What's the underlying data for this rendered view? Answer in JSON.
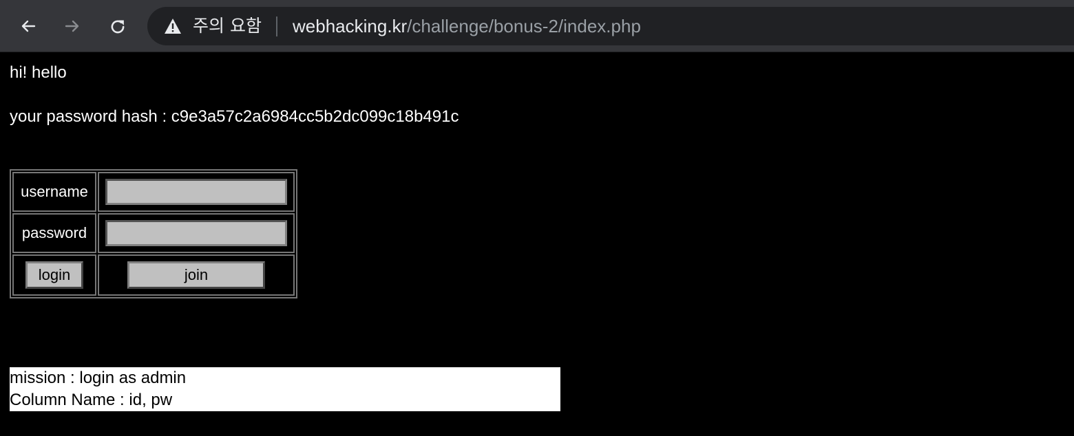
{
  "browser": {
    "security_warning": "주의 요함",
    "url_host": "webhacking.kr",
    "url_path": "/challenge/bonus-2/index.php",
    "icons": {
      "back": "back-arrow-icon",
      "forward": "forward-arrow-icon",
      "reload": "reload-icon",
      "warning": "warning-triangle-icon"
    }
  },
  "page": {
    "greeting": "hi! hello",
    "hash_line": "your password hash : c9e3a57c2a6984cc5b2dc099c18b491c",
    "form": {
      "username_label": "username",
      "password_label": "password",
      "username_value": "",
      "password_value": "",
      "login_button": "login",
      "join_button": "join"
    },
    "mission": {
      "line1": "mission : login as admin",
      "line2": "Column Name : id, pw"
    }
  },
  "colors": {
    "page_background": "#000000",
    "chrome_toolbar": "#35363a",
    "omnibox": "#202124",
    "form_field": "#c0c0c0",
    "mission_background": "#ffffff"
  }
}
